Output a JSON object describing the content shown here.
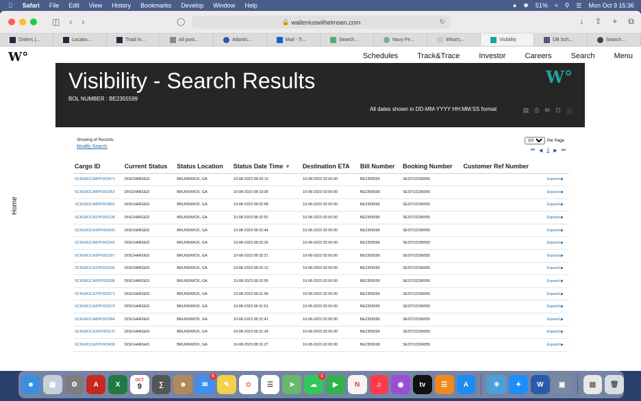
{
  "menubar": {
    "apple": "",
    "app_name": "Safari",
    "menus": [
      "File",
      "Edit",
      "View",
      "History",
      "Bookmarks",
      "Develop",
      "Window",
      "Help"
    ],
    "battery": "51%",
    "clock": "Mon Oct 9  15:36"
  },
  "browser": {
    "url": "walleniuswilhelmsen.com",
    "tabs": [
      {
        "label": "Orders |...",
        "active": false
      },
      {
        "label": "Locatio...",
        "active": false
      },
      {
        "label": "Triad In...",
        "active": false
      },
      {
        "label": "All post...",
        "active": false
      },
      {
        "label": "Atlantic...",
        "active": false
      },
      {
        "label": "Mail - Ti...",
        "active": false
      },
      {
        "label": "Search...",
        "active": false
      },
      {
        "label": "Navy Fe...",
        "active": false
      },
      {
        "label": "What's...",
        "active": false
      },
      {
        "label": "Visibility",
        "active": true
      },
      {
        "label": "DB Sch...",
        "active": false
      },
      {
        "label": "Search...",
        "active": false
      }
    ]
  },
  "site": {
    "logo": "W°",
    "nav": [
      "Schedules",
      "Track&Trace",
      "Investor",
      "Careers",
      "Search",
      "Menu"
    ],
    "side_label": "Home"
  },
  "banner": {
    "title": "Visibility - Search Results",
    "bol": "BOL NUMBER : BE2355599",
    "date_format_note": "All dates shown in DD-MM-YYYY HH:MM:SS format",
    "logo": "W°"
  },
  "results": {
    "showing_label": "Showing of Records",
    "modify_label": "Modify Search",
    "per_page_value": "1000",
    "per_page_label": "Per Page",
    "current_page": "1",
    "columns": [
      "Cargo ID",
      "Current Status",
      "Status Location",
      "Status Date Time",
      "Destination ETA",
      "Bill Number",
      "Booking Number",
      "Customer Ref Number"
    ],
    "expand_label": "Expand",
    "rows": [
      [
        "SC6GM1CA8PF003471",
        "DISCHARGED",
        "BRUNSWICK, GA",
        "10-08-2023 08:33:13",
        "10-08-2023 02:00:00",
        "BE2355599",
        "SESTO2296055",
        ""
      ],
      [
        "SC6GM1CA8PF003353",
        "DISCHARGED",
        "BRUNSWICK, GA",
        "10-08-2023 08:33:05",
        "10-08-2023 02:00:00",
        "BE2355599",
        "SESTO2296055",
        ""
      ],
      [
        "SC6GM1CA8PF003802",
        "DISCHARGED",
        "BRUNSWICK, GA",
        "10-08-2023 08:32:58",
        "10-08-2023 02:00:00",
        "BE2355599",
        "SESTO2296055",
        ""
      ],
      [
        "SC6GM1CA1PF003138",
        "DISCHARGED",
        "BRUNSWICK, GA",
        "10-08-2023 08:32:52",
        "10-08-2023 02:00:00",
        "BE2355599",
        "SESTO2296055",
        ""
      ],
      [
        "SC6GM1CAXPF003431",
        "DISCHARGED",
        "BRUNSWICK, GA",
        "10-08-2023 08:32:44",
        "10-08-2023 02:00:00",
        "BE2355599",
        "SESTO2296055",
        ""
      ],
      [
        "SC6GM1CA6PF003345",
        "DISCHARGED",
        "BRUNSWICK, GA",
        "10-08-2023 08:32:26",
        "10-08-2023 02:00:00",
        "BE2355599",
        "SESTO2296055",
        ""
      ],
      [
        "SC6GM1CA3PF003397",
        "DISCHARGED",
        "BRUNSWICK, GA",
        "10-08-2023 08:32:21",
        "10-08-2023 02:00:00",
        "BE2355599",
        "SESTO2296055",
        ""
      ],
      [
        "SC6GM1CA1PF003396",
        "DISCHARGED",
        "BRUNSWICK, GA",
        "10-08-2023 08:32:12",
        "10-08-2023 02:00:00",
        "BE2355599",
        "SESTO2296055",
        ""
      ],
      [
        "SC6GM1CA5PF003398",
        "DISCHARGED",
        "BRUNSWICK, GA",
        "10-08-2023 08:32:05",
        "10-08-2023 02:00:00",
        "BE2355599",
        "SESTO2296055",
        ""
      ],
      [
        "SC6GM1CA7PF003371",
        "DISCHARGED",
        "BRUNSWICK, GA",
        "10-08-2023 08:31:58",
        "10-08-2023 02:00:00",
        "BE2355599",
        "SESTO2296055",
        ""
      ],
      [
        "SC6GM1CA2PF003374",
        "DISCHARGED",
        "BRUNSWICK, GA",
        "10-08-2023 08:31:51",
        "10-08-2023 02:00:00",
        "BE2355599",
        "SESTO2296055",
        ""
      ],
      [
        "SC6GM1CA8PF003384",
        "DISCHARGED",
        "BRUNSWICK, GA",
        "10-08-2023 08:31:41",
        "10-08-2023 02:00:00",
        "BE2355599",
        "SESTO2296055",
        ""
      ],
      [
        "SC6GM1CAXPF003137",
        "DISCHARGED",
        "BRUNSWICK, GA",
        "10-08-2023 08:31:34",
        "10-08-2023 02:00:00",
        "BE2355599",
        "SESTO2296055",
        ""
      ],
      [
        "SC6GM1CA2PF003438",
        "DISCHARGED",
        "BRUNSWICK, GA",
        "10-08-2023 08:31:27",
        "10-08-2023 02:00:00",
        "BE2355599",
        "SESTO2296055",
        ""
      ]
    ]
  },
  "dock": {
    "calendar_month": "OCT",
    "calendar_day": "9",
    "mail_badge": "5",
    "messages_badge": "1",
    "apps": [
      "finder",
      "launchpad",
      "system-preferences",
      "acrobat",
      "excel",
      "calendar",
      "calculator",
      "contacts",
      "mail",
      "notes",
      "photos",
      "reminders",
      "maps",
      "messages",
      "facetime",
      "news",
      "music",
      "podcasts",
      "tv",
      "books",
      "app-store",
      "network",
      "safari",
      "word",
      "preview",
      "files",
      "trash"
    ]
  },
  "colors": {
    "banner_bg": "#262626",
    "link": "#1f6fae",
    "teal": "#20a39e"
  }
}
